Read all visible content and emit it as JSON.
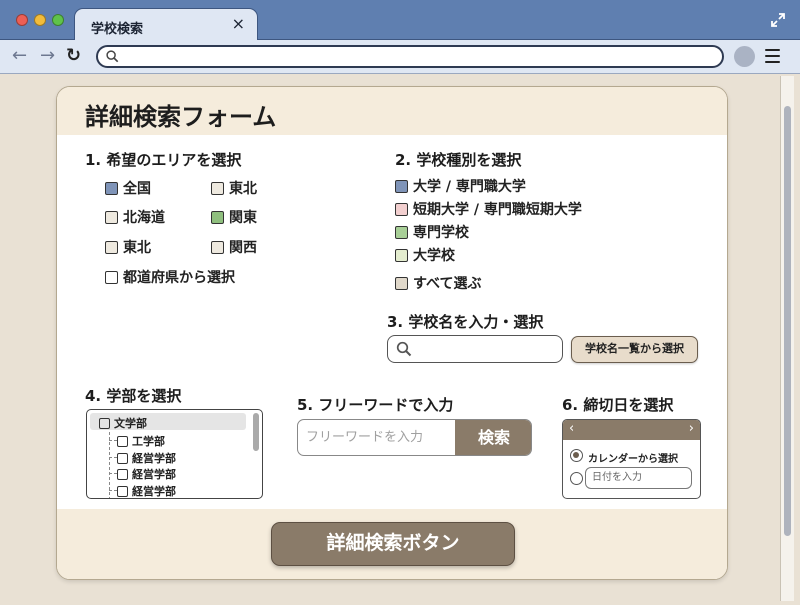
{
  "browser": {
    "tab_title": "学校検索",
    "tab_close": "×",
    "url_value": ""
  },
  "form": {
    "title": "詳細検索フォーム",
    "sections": {
      "area": {
        "title": "1. 希望のエリアを選択"
      },
      "school_type": {
        "title": "2. 学校種別を選択"
      },
      "school_name": {
        "title": "3. 学校名を入力・選択"
      },
      "department": {
        "title": "4. 学部を選択"
      },
      "free_word": {
        "title": "5. フリーワードで入力"
      },
      "deadline": {
        "title": "6. 締切日を選択"
      }
    },
    "areas": [
      {
        "label": "全国",
        "color": "#7f94b8"
      },
      {
        "label": "東北",
        "color": "#eee9df"
      },
      {
        "label": "北海道",
        "color": "#eee9df"
      },
      {
        "label": "関東",
        "color": "#8fbf7e"
      },
      {
        "label": "東北",
        "color": "#eee9df"
      },
      {
        "label": "関西",
        "color": "#eee9df"
      },
      {
        "label": "都道府県から選択",
        "color": "#ffffff"
      }
    ],
    "school_types": [
      {
        "label": "大学 / 専門職大学",
        "color": "#7f94b8"
      },
      {
        "label": "短期大学 / 専門職短期大学",
        "color": "#f2cfcf"
      },
      {
        "label": "専門学校",
        "color": "#a8cf97"
      },
      {
        "label": "大学校",
        "color": "#e4edcf"
      },
      {
        "label": "すべて選ぶ",
        "color": "#e0d8ca"
      }
    ],
    "school_name_search": {
      "value": "",
      "placeholder": ""
    },
    "school_list_button": "学校名一覧から選択",
    "departments": [
      {
        "label": "文学部",
        "selected": true
      },
      {
        "label": "工学部"
      },
      {
        "label": "経営学部"
      },
      {
        "label": "経営学部"
      },
      {
        "label": "経営学部"
      }
    ],
    "free_word": {
      "placeholder": "フリーワードを入力",
      "button": "検索"
    },
    "deadline": {
      "prev": "‹",
      "next": "›",
      "calendar_option": "カレンダーから選択",
      "date_placeholder": "日付を入力"
    },
    "submit_button": "詳細検索ボタン"
  }
}
